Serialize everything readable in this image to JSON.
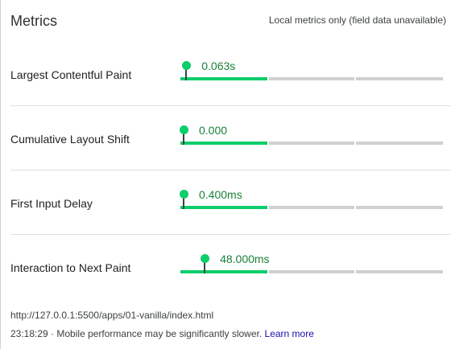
{
  "header": {
    "title": "Metrics",
    "note": "Local metrics only (field data unavailable)"
  },
  "metrics": [
    {
      "label": "Largest Contentful Paint",
      "value": "0.063s",
      "position_fraction": 0.01
    },
    {
      "label": "Cumulative Layout Shift",
      "value": "0.000",
      "position_fraction": 0.0
    },
    {
      "label": "First Input Delay",
      "value": "0.400ms",
      "position_fraction": 0.0
    },
    {
      "label": "Interaction to Next Paint",
      "value": "48.000ms",
      "position_fraction": 0.08
    }
  ],
  "footer": {
    "url": "http://127.0.0.1:5500/apps/01-vanilla/index.html",
    "time": "23:18:29",
    "separator": " · ",
    "message": "Mobile performance may be significantly slower. ",
    "link": "Learn more"
  },
  "colors": {
    "good": "#0cce6b",
    "neutral": "#d0d0d0",
    "value_text": "#188038",
    "link": "#1a0dab"
  }
}
